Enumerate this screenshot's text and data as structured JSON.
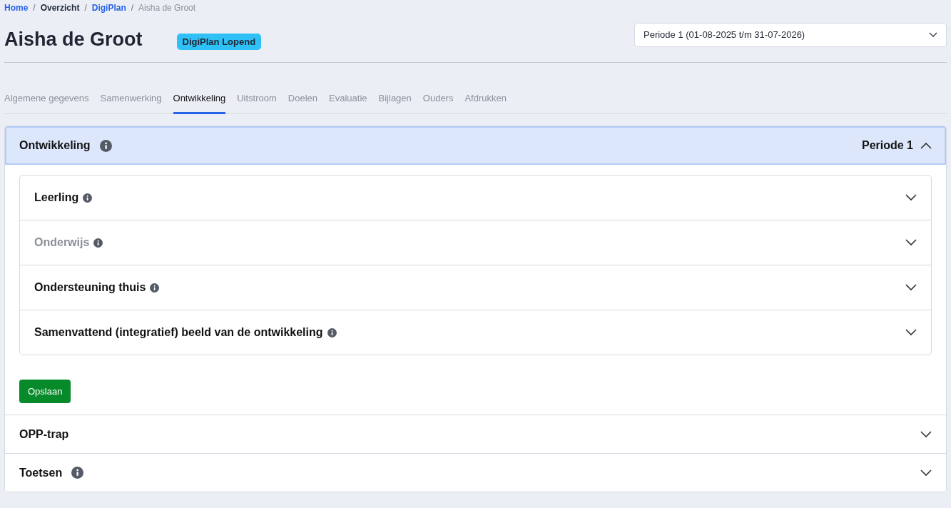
{
  "breadcrumb": [
    {
      "label": "Home",
      "kind": "link"
    },
    {
      "label": "Overzicht",
      "kind": "text"
    },
    {
      "label": "DigiPlan",
      "kind": "link"
    },
    {
      "label": "Aisha de Groot",
      "kind": "current"
    }
  ],
  "breadcrumb_separator": "/",
  "title": "Aisha de Groot",
  "status_badge": "DigiPlan Lopend",
  "period_select": {
    "value": "Periode 1 (01-08-2025 t/m 31-07-2026)"
  },
  "tabs": [
    {
      "label": "Algemene gegevens",
      "selected": false
    },
    {
      "label": "Samenwerking",
      "selected": false
    },
    {
      "label": "Ontwikkeling",
      "selected": true
    },
    {
      "label": "Uitstroom",
      "selected": false
    },
    {
      "label": "Doelen",
      "selected": false
    },
    {
      "label": "Evaluatie",
      "selected": false
    },
    {
      "label": "Bijlagen",
      "selected": false
    },
    {
      "label": "Ouders",
      "selected": false
    },
    {
      "label": "Afdrukken",
      "selected": false
    }
  ],
  "sections": [
    {
      "title": "Ontwikkeling",
      "info": true,
      "expanded": true,
      "period": "Periode 1",
      "items": [
        {
          "title": "Leerling",
          "info": true,
          "muted": false,
          "expanded": false
        },
        {
          "title": "Onderwijs",
          "info": true,
          "muted": true,
          "expanded": false
        },
        {
          "title": "Ondersteuning thuis",
          "info": true,
          "muted": false,
          "expanded": false
        },
        {
          "title": "Samenvattend (integratief) beeld van de ontwikkeling",
          "info": true,
          "muted": false,
          "expanded": false
        }
      ],
      "save_button": "Opslaan"
    },
    {
      "title": "OPP-trap",
      "info": false,
      "expanded": false
    },
    {
      "title": "Toetsen",
      "info": true,
      "expanded": false
    }
  ]
}
